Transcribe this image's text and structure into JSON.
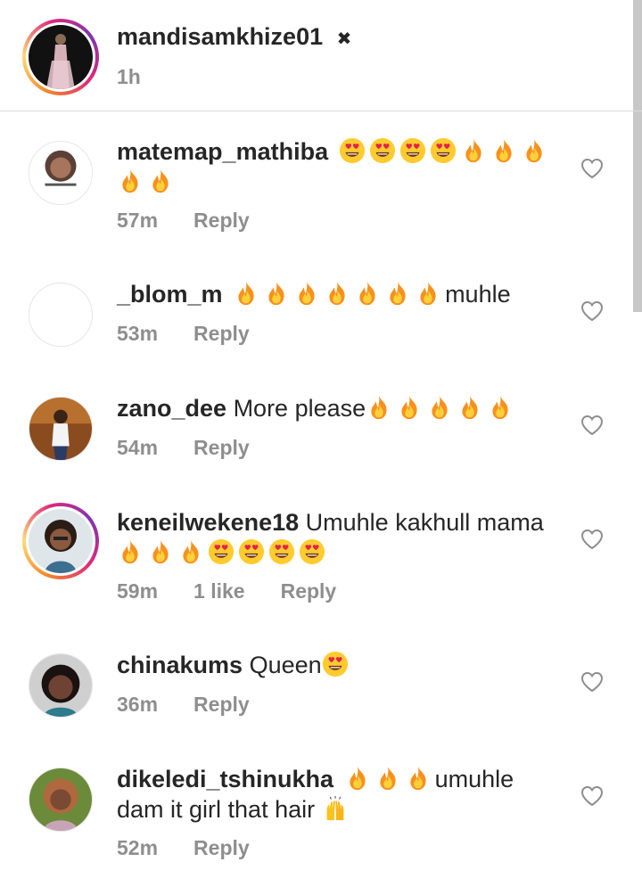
{
  "caption": {
    "username": "mandisamkhize01",
    "badge": "✖",
    "time": "1h"
  },
  "comments": [
    {
      "username": "matemap_mathiba",
      "text_line1": "😍😍😍😍🔥🔥🔥",
      "text_line2": "🔥🔥",
      "time": "57m",
      "reply": "Reply"
    },
    {
      "username": "_blom_m",
      "text": "🔥🔥🔥🔥🔥🔥🔥muhle",
      "time": "53m",
      "reply": "Reply"
    },
    {
      "username": "zano_dee",
      "text": "More please🔥🔥🔥🔥🔥",
      "time": "54m",
      "reply": "Reply"
    },
    {
      "username": "keneilwekene18",
      "text_line1": "Umuhle kakhull mama",
      "text_line2": "🔥🔥🔥😍😍😍😍",
      "time": "59m",
      "likes": "1 like",
      "reply": "Reply"
    },
    {
      "username": "chinakums",
      "text": "Queen😍",
      "time": "36m",
      "reply": "Reply"
    },
    {
      "username": "dikeledi_tshinukha",
      "text_line1": "🔥🔥🔥umuhle",
      "text_line2": "dam it girl that hair 🙌",
      "time": "52m",
      "reply": "Reply"
    }
  ],
  "icons": {
    "like": "heart-outline-icon",
    "fire": "fire-emoji",
    "heart_eyes": "heart-eyes-emoji",
    "raised_hands": "raised-hands-emoji"
  },
  "colors": {
    "text": "#262626",
    "meta": "#8e8e8e",
    "divider": "#dbdbdb",
    "story_ring_start": "#f58529",
    "story_ring_end": "#8134af"
  }
}
